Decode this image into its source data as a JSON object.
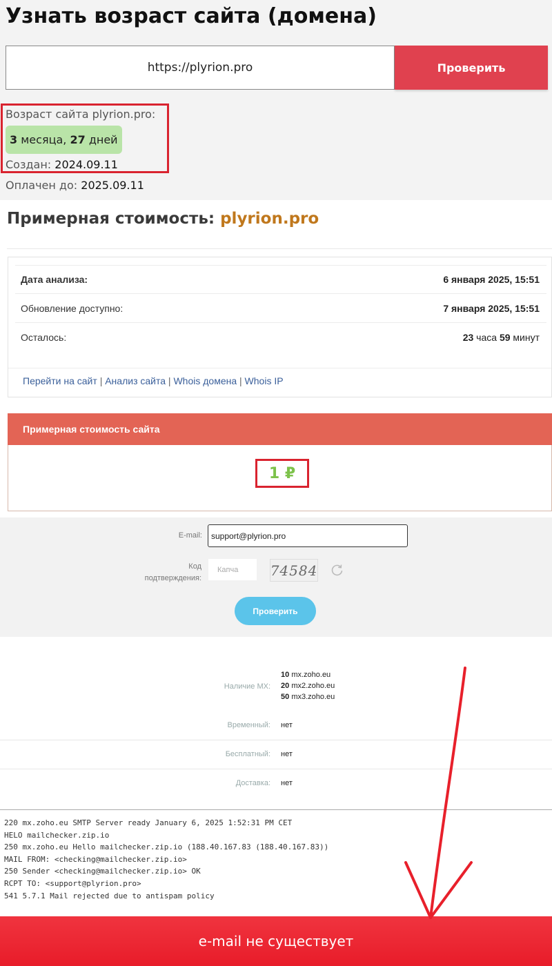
{
  "page": {
    "title": "Узнать возраст сайта (домена)",
    "url_value": "https://plyrion.pro",
    "check_button": "Проверить"
  },
  "age": {
    "label": "Возраст сайта plyrion.pro:",
    "months_num": "3",
    "months_word": "месяца,",
    "days_num": "27",
    "days_word": "дней",
    "created_label": "Создан:",
    "created_value": "2024.09.11",
    "paid_label": "Оплачен до:",
    "paid_value": "2025.09.11"
  },
  "cost": {
    "title_prefix": "Примерная стоимость:",
    "domain": "plyrion.pro",
    "rows": [
      {
        "label": "Дата анализа:",
        "value": "6 января 2025, 15:51"
      },
      {
        "label": "Обновление доступно:",
        "value": "7 января 2025, 15:51"
      },
      {
        "label": "Осталось:",
        "hours": "23",
        "hours_word": "часа",
        "minutes": "59",
        "minutes_word": "минут"
      }
    ],
    "links": [
      "Перейти на сайт",
      "Анализ сайта",
      "Whois домена",
      "Whois IP"
    ],
    "link_separator": "|"
  },
  "valuation": {
    "header": "Примерная стоимость сайта",
    "value": "1 ₽"
  },
  "email_form": {
    "email_label": "E-mail:",
    "email_value": "support@plyrion.pro",
    "code_label_line1": "Код",
    "code_label_line2": "подтверждения:",
    "captcha_placeholder": "Капча",
    "captcha_text": "74584",
    "check_button": "Проверить"
  },
  "mx": {
    "mx_label": "Наличие MX:",
    "records": [
      {
        "priority": "10",
        "host": "mx.zoho.eu"
      },
      {
        "priority": "20",
        "host": "mx2.zoho.eu"
      },
      {
        "priority": "50",
        "host": "mx3.zoho.eu"
      }
    ],
    "temp_label": "Временный:",
    "temp_value": "нет",
    "free_label": "Бесплатный:",
    "free_value": "нет",
    "delivery_label": "Доставка:",
    "delivery_value": "нет"
  },
  "smtp_log": [
    "220 mx.zoho.eu SMTP Server ready January 6, 2025 1:52:31 PM CET",
    "HELO mailchecker.zip.io",
    "250 mx.zoho.eu Hello mailchecker.zip.io (188.40.167.83 (188.40.167.83))",
    "MAIL FROM: <checking@mailchecker.zip.io>",
    "250 Sender <checking@mailchecker.zip.io> OK",
    "RCPT TO: <support@plyrion.pro>",
    "541 5.7.1 Mail rejected due to antispam policy"
  ],
  "result": {
    "text": "e-mail не существует"
  },
  "colors": {
    "accent_red": "#e0414f",
    "annotation_red": "#d9232f",
    "value_green": "#7dc24b",
    "badge_green": "#b9e4a8",
    "domain_orange": "#c0781d",
    "button_blue": "#5bc4ea"
  }
}
